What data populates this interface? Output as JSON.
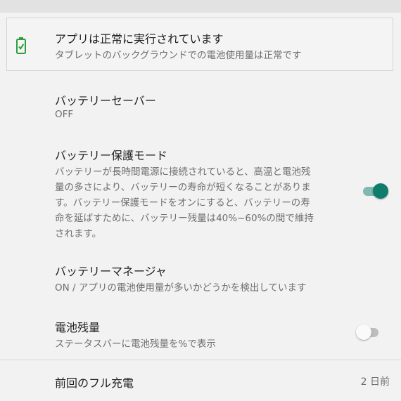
{
  "status_card": {
    "title": "アプリは正常に実行されています",
    "subtitle": "タブレットのバックグラウンドでの電池使用量は正常です",
    "icon": "battery-icon",
    "icon_color": "#2e9e3f"
  },
  "battery_saver": {
    "title": "バッテリーセーバー",
    "value": "OFF"
  },
  "battery_protection": {
    "title": "バッテリー保護モード",
    "description_lines": [
      "バッテリーが長時間電源に接続されていると、高温と電池残",
      "量の多さにより、バッテリーの寿命が短くなることがありま",
      "す。バッテリー保護モードをオンにすると、バッテリーの寿",
      "命を延ばすために、バッテリー残量は40%~60%の間で維持",
      "されます。"
    ],
    "enabled": true
  },
  "battery_manager": {
    "title": "バッテリーマネージャ",
    "subtitle": "ON / アプリの電池使用量が多いかどうかを検出しています"
  },
  "battery_percentage": {
    "title": "電池残量",
    "subtitle": "ステータスバーに電池残量を%で表示",
    "enabled": false
  },
  "last_full_charge": {
    "title": "前回のフル充電",
    "value": "2 日前"
  },
  "colors": {
    "accent": "#0f7d6e",
    "background": "#f2f2f2"
  }
}
